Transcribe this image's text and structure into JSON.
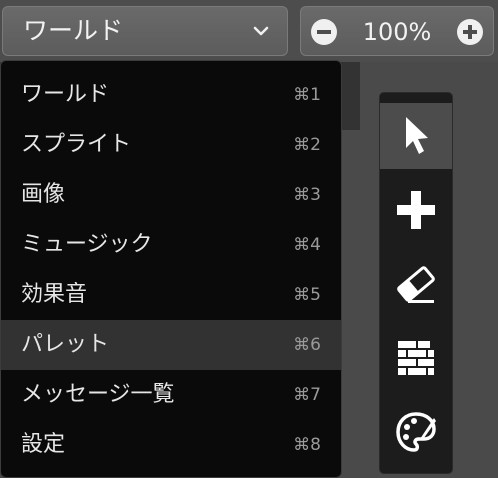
{
  "view_select": {
    "label": "ワールド",
    "icon": "chevron-down-icon"
  },
  "zoom": {
    "value": "100%",
    "minus_icon": "minus-circle-icon",
    "plus_icon": "plus-circle-icon"
  },
  "menu": {
    "items": [
      {
        "label": "ワールド",
        "shortcut": "⌘1"
      },
      {
        "label": "スプライト",
        "shortcut": "⌘2"
      },
      {
        "label": "画像",
        "shortcut": "⌘3"
      },
      {
        "label": "ミュージック",
        "shortcut": "⌘4"
      },
      {
        "label": "効果音",
        "shortcut": "⌘5"
      },
      {
        "label": "パレット",
        "shortcut": "⌘6",
        "highlighted": true
      },
      {
        "label": "メッセージ一覧",
        "shortcut": "⌘7"
      },
      {
        "label": "設定",
        "shortcut": "⌘8"
      }
    ]
  },
  "tools": [
    {
      "name": "select",
      "icon": "cursor-arrow-icon",
      "selected": true
    },
    {
      "name": "add",
      "icon": "plus-icon"
    },
    {
      "name": "erase",
      "icon": "eraser-icon"
    },
    {
      "name": "tiles",
      "icon": "brick-wall-icon"
    },
    {
      "name": "palette",
      "icon": "palette-icon"
    }
  ],
  "colors": {
    "menu_bg": "#0a0a0a",
    "highlight": "#323232",
    "button": "#5c5c5c",
    "toolbox": "#1c1c1c"
  }
}
